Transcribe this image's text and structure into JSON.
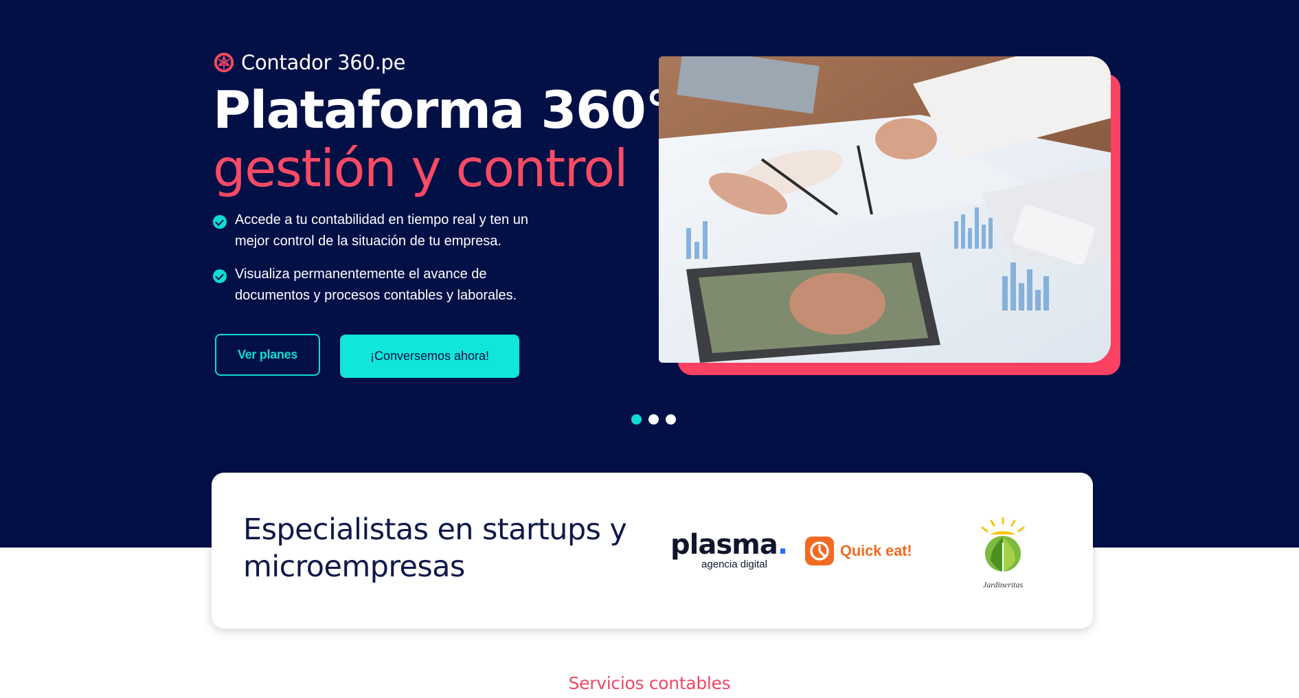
{
  "brand": {
    "name": "Contador 360.pe",
    "icon": "globe-wire-icon"
  },
  "hero": {
    "title_line1": "Plataforma 360°",
    "title_line2": "gestión y control",
    "bullets": [
      {
        "text": "Accede a tu contabilidad en tiempo real y ten un mejor control de la situación de tu empresa.",
        "icon": "check-circle-icon"
      },
      {
        "text": "Visualiza permanentemente el avance de documentos y procesos contables y laborales.",
        "icon": "check-circle-icon"
      }
    ],
    "buttons": {
      "plans": "Ver planes",
      "chat": "¡Conversemos ahora!"
    },
    "photo_image": "business-meeting-charts-photo"
  },
  "carousel": {
    "slides": 3,
    "active": 1
  },
  "clients": {
    "title": "Especialistas en startups y microempresas",
    "logos": {
      "plasma": {
        "name": "plasma",
        "dot": ".",
        "sub": "agencia digital"
      },
      "quickeat": {
        "name": "Quick eat!"
      },
      "jardineritas": {
        "name": "Jardineritas"
      }
    }
  },
  "services": {
    "label": "Servicios contables"
  },
  "colors": {
    "navy": "#021046",
    "coral": "#fa4a64",
    "cyan": "#10e6da",
    "card_title": "#0f1848"
  }
}
